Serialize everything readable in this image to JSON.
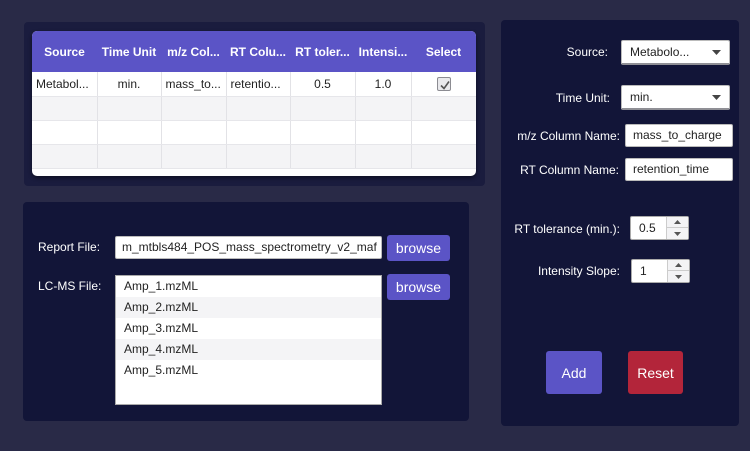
{
  "table": {
    "headers": [
      "Source",
      "Time Unit",
      "m/z Col...",
      "RT Colu...",
      "RT toler...",
      "Intensi...",
      "Select"
    ],
    "rows": [
      [
        "Metabol...",
        "min.",
        "mass_to...",
        "retentio...",
        "0.5",
        "1.0",
        "checked"
      ]
    ]
  },
  "files": {
    "report_label": "Report File:",
    "report_value": "m_mtbls484_POS_mass_spectrometry_v2_maf",
    "lcms_label": "LC-MS File:",
    "browse_label": "browse",
    "lcms_files": [
      "Amp_1.mzML",
      "Amp_2.mzML",
      "Amp_3.mzML",
      "Amp_4.mzML",
      "Amp_5.mzML"
    ]
  },
  "form": {
    "source_label": "Source:",
    "source_value": "Metabolo...",
    "time_unit_label": "Time Unit:",
    "time_unit_value": "min.",
    "mz_label": "m/z Column Name:",
    "mz_value": "mass_to_charge",
    "rt_label": "RT Column Name:",
    "rt_value": "retention_time",
    "rt_tol_label": "RT tolerance (min.):",
    "rt_tol_value": "0.5",
    "intensity_label": "Intensity Slope:",
    "intensity_value": "1",
    "add_label": "Add",
    "reset_label": "Reset"
  },
  "colors": {
    "background": "#292a47",
    "panel": "#121538",
    "accent": "#5b54c6",
    "reset": "#b3253a"
  }
}
